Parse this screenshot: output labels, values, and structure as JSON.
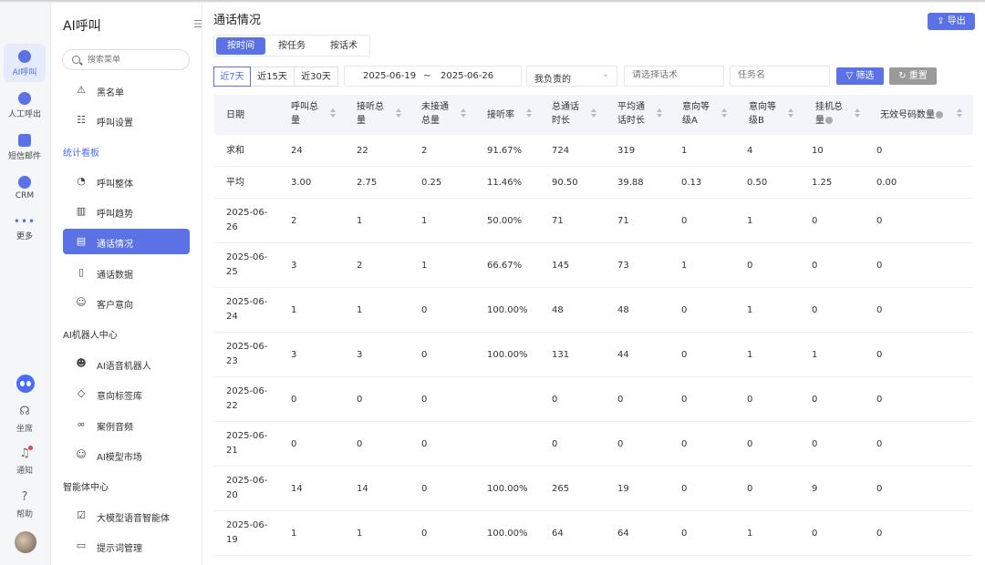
{
  "rail": {
    "items": [
      {
        "label": "AI呼叫",
        "icon": "ai-call-icon"
      },
      {
        "label": "人工呼出",
        "icon": "manual-call-icon"
      },
      {
        "label": "短信邮件",
        "icon": "sms-mail-icon"
      },
      {
        "label": "CRM",
        "icon": "crm-icon"
      },
      {
        "label": "更多",
        "icon": "more-icon"
      }
    ],
    "bottom": [
      {
        "label": "坐席",
        "icon": "headset-icon"
      },
      {
        "label": "通知",
        "icon": "bell-icon"
      },
      {
        "label": "帮助",
        "icon": "help-icon"
      }
    ]
  },
  "sidebar": {
    "title": "AI呼叫",
    "search_placeholder": "搜索菜单",
    "items": [
      {
        "label": "黑名单",
        "icon": "warning-icon"
      },
      {
        "label": "呼叫设置",
        "icon": "sliders-icon"
      },
      {
        "group": "统计看板"
      },
      {
        "label": "呼叫整体",
        "icon": "pie-chart-icon"
      },
      {
        "label": "呼叫趋势",
        "icon": "bar-chart-icon"
      },
      {
        "label": "通话情况",
        "icon": "document-icon"
      },
      {
        "label": "通话数据",
        "icon": "file-search-icon"
      },
      {
        "label": "客户意向",
        "icon": "smile-icon"
      },
      {
        "group": "AI机器人中心"
      },
      {
        "label": "AI语音机器人",
        "icon": "robot-icon"
      },
      {
        "label": "意向标签库",
        "icon": "tag-icon"
      },
      {
        "label": "案例音频",
        "icon": "audio-icon"
      },
      {
        "label": "AI模型市场",
        "icon": "market-icon"
      },
      {
        "group": "智能体中心"
      },
      {
        "label": "大模型语音智能体",
        "icon": "agent-icon"
      },
      {
        "label": "提示词管理",
        "icon": "prompt-icon"
      }
    ]
  },
  "main": {
    "title": "通话情况",
    "export_label": "导出",
    "tabs": [
      "按时间",
      "按任务",
      "按话术"
    ],
    "ranges": [
      "近7天",
      "近15天",
      "近30天"
    ],
    "date_start": "2025-06-19",
    "date_sep": "~",
    "date_end": "2025-06-26",
    "owner_select": "我负责的",
    "script_placeholder": "请选择话术",
    "task_placeholder": "任务名",
    "filter_label": "筛选",
    "reset_label": "重置"
  },
  "table": {
    "columns": [
      {
        "l1": "日期",
        "l2": ""
      },
      {
        "l1": "呼叫总",
        "l2": "量"
      },
      {
        "l1": "接听总",
        "l2": "量"
      },
      {
        "l1": "未接通",
        "l2": "总量"
      },
      {
        "l1": "接听率",
        "l2": ""
      },
      {
        "l1": "总通话",
        "l2": "时长"
      },
      {
        "l1": "平均通",
        "l2": "话时长"
      },
      {
        "l1": "意向等",
        "l2": "级A"
      },
      {
        "l1": "意向等",
        "l2": "级B"
      },
      {
        "l1": "挂机总",
        "l2": "量"
      },
      {
        "l1": "无效号码数量",
        "l2": ""
      }
    ],
    "rows": [
      [
        "求和",
        "24",
        "22",
        "2",
        "91.67%",
        "724",
        "319",
        "1",
        "4",
        "10",
        "0"
      ],
      [
        "平均",
        "3.00",
        "2.75",
        "0.25",
        "11.46%",
        "90.50",
        "39.88",
        "0.13",
        "0.50",
        "1.25",
        "0.00"
      ],
      [
        "2025-06-26",
        "2",
        "1",
        "1",
        "50.00%",
        "71",
        "71",
        "0",
        "1",
        "0",
        "0"
      ],
      [
        "2025-06-25",
        "3",
        "2",
        "1",
        "66.67%",
        "145",
        "73",
        "1",
        "0",
        "0",
        "0"
      ],
      [
        "2025-06-24",
        "1",
        "1",
        "0",
        "100.00%",
        "48",
        "48",
        "0",
        "1",
        "0",
        "0"
      ],
      [
        "2025-06-23",
        "3",
        "3",
        "0",
        "100.00%",
        "131",
        "44",
        "0",
        "1",
        "1",
        "0"
      ],
      [
        "2025-06-22",
        "0",
        "0",
        "0",
        "",
        "0",
        "0",
        "0",
        "0",
        "0",
        "0"
      ],
      [
        "2025-06-21",
        "0",
        "0",
        "0",
        "",
        "0",
        "0",
        "0",
        "0",
        "0",
        "0"
      ],
      [
        "2025-06-20",
        "14",
        "14",
        "0",
        "100.00%",
        "265",
        "19",
        "0",
        "0",
        "9",
        "0"
      ],
      [
        "2025-06-19",
        "1",
        "1",
        "0",
        "100.00%",
        "64",
        "64",
        "0",
        "1",
        "0",
        "0"
      ]
    ]
  },
  "colors": {
    "accent": "#5a72e6",
    "reset": "#9a9a9a",
    "header_bg": "#f3f5fa"
  }
}
